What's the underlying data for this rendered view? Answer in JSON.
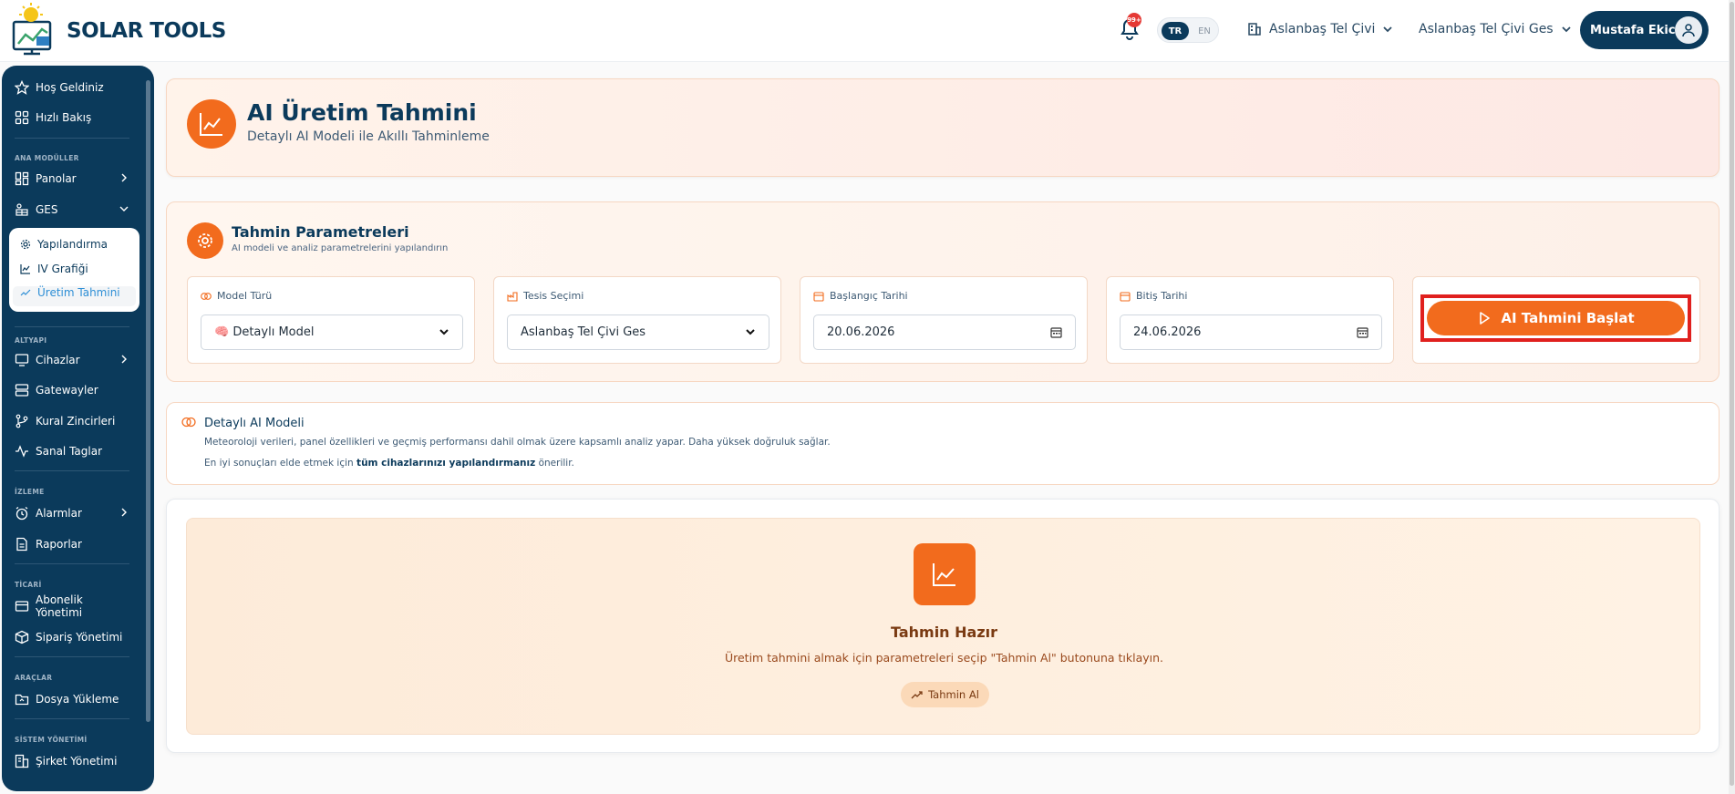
{
  "header": {
    "logo_text": "SOLAR TOOLS",
    "notification_badge": "99+",
    "lang_active": "TR",
    "lang_other": "EN",
    "company": "Aslanbaş Tel Çivi",
    "site": "Aslanbaş Tel Çivi Ges",
    "user_name": "Mustafa Ekici"
  },
  "sidebar": {
    "welcome": "Hoş Geldiniz",
    "quick": "Hızlı Bakış",
    "sec_main": "ANA MODÜLLER",
    "panels": "Panolar",
    "ges": "GES",
    "sub_config": "Yapılandırma",
    "sub_iv": "IV Grafiği",
    "sub_forecast": "Üretim Tahmini",
    "sec_infra": "ALTYAPI",
    "devices": "Cihazlar",
    "gateways": "Gatewayler",
    "rules": "Kural Zincirleri",
    "virtual_tags": "Sanal Taglar",
    "sec_monitor": "İZLEME",
    "alarms": "Alarmlar",
    "reports": "Raporlar",
    "sec_commercial": "TİCARİ",
    "subscription": "Abonelik Yönetimi",
    "orders": "Sipariş Yönetimi",
    "sec_tools": "ARAÇLAR",
    "upload": "Dosya Yükleme",
    "sec_system": "SİSTEM YÖNETİMİ",
    "company_mgmt": "Şirket Yönetimi"
  },
  "hero": {
    "title": "AI Üretim Tahmini",
    "subtitle": "Detaylı AI Modeli ile Akıllı Tahminleme"
  },
  "params": {
    "title": "Tahmin Parametreleri",
    "subtitle": "AI modeli ve analiz parametrelerini yapılandırın",
    "model_label": "Model Türü",
    "model_value": "🧠 Detaylı Model",
    "facility_label": "Tesis Seçimi",
    "facility_value": "Aslanbaş Tel Çivi Ges",
    "start_label": "Başlangıç Tarihi",
    "start_value": "20.06.2026",
    "end_label": "Bitiş Tarihi",
    "end_value": "24.06.2026",
    "start_button": "AI Tahmini Başlat"
  },
  "info": {
    "title": "Detaylı AI Modeli",
    "line1": "Meteoroloji verileri, panel özellikleri ve geçmiş performansı dahil olmak üzere kapsamlı analiz yapar. Daha yüksek doğruluk sağlar.",
    "line2_pre": "En iyi sonuçları elde etmek için ",
    "line2_bold": "tüm cihazlarınızı yapılandırmanız",
    "line2_post": " önerilir."
  },
  "result": {
    "title": "Tahmin Hazır",
    "subtitle": "Üretim tahmini almak için parametreleri seçip \"Tahmin Al\" butonuna tıklayın.",
    "button": "Tahmin Al"
  },
  "colors": {
    "brand_navy": "#0b3a5b",
    "accent_orange": "#f26b1d",
    "highlight_red": "#e0201e"
  }
}
